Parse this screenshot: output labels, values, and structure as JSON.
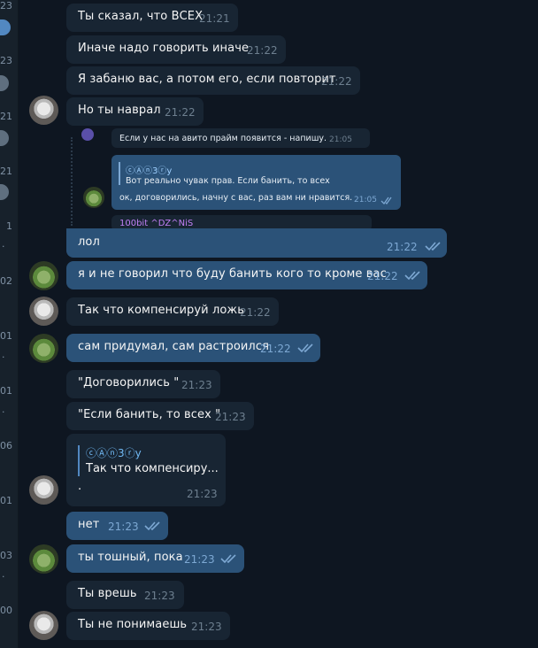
{
  "sidebar_counters": [
    "23",
    "23",
    "21",
    "21",
    "1",
    "02",
    "01",
    "01",
    "06",
    "01",
    "03",
    "00"
  ],
  "messages": [
    {
      "text": "Ты сказал, что ВСЕХ",
      "time": "21:21"
    },
    {
      "text": "Иначе надо говорить иначе",
      "time": "21:22"
    },
    {
      "text": "Я забаню вас, а потом его, если повторит",
      "time": "21:22"
    },
    {
      "text": "Но ты наврал",
      "time": "21:22"
    },
    {
      "text": "лол",
      "time": "21:22"
    },
    {
      "text": "я и не говорил что буду банить кого то кроме вас",
      "time": "21:22"
    },
    {
      "text": "Так что компенсируй ложь",
      "time": "21:22"
    },
    {
      "text": "сам придумал, сам растроился",
      "time": "21:22"
    },
    {
      "text": "\"Договорились \"",
      "time": "21:23"
    },
    {
      "text": "\"Если банить, то всех \"",
      "time": "21:23"
    },
    {
      "text": ".",
      "time": "21:23",
      "reply_author": "ⓒⒶⓝ3ⓡy",
      "reply_text": "Так что компенсиру..."
    },
    {
      "text": "нет",
      "time": "21:23"
    },
    {
      "text": "ты тошный, пока",
      "time": "21:23"
    },
    {
      "text": "Ты врешь",
      "time": "21:23"
    },
    {
      "text": "Ты не понимаешь",
      "time": "21:23"
    }
  ],
  "embedded": {
    "msg1_text": "Если у нас на авито прайм появится - напишу.",
    "msg1_time": "21:05",
    "author": "ⓒⒶⓝ3ⓡy",
    "quote_text": "Вот реально чувак прав. Если банить, то всех",
    "msg2_text": "ок, договорились, начну с вас, раз вам ни нравится.",
    "msg2_time": "21:05",
    "next_author": "100bit ^DZ^NiS"
  },
  "colors": {
    "background": "#0e1621",
    "incoming_bubble": "#182533",
    "outgoing_bubble": "#2b5278",
    "read_check": "#7da8d3"
  }
}
